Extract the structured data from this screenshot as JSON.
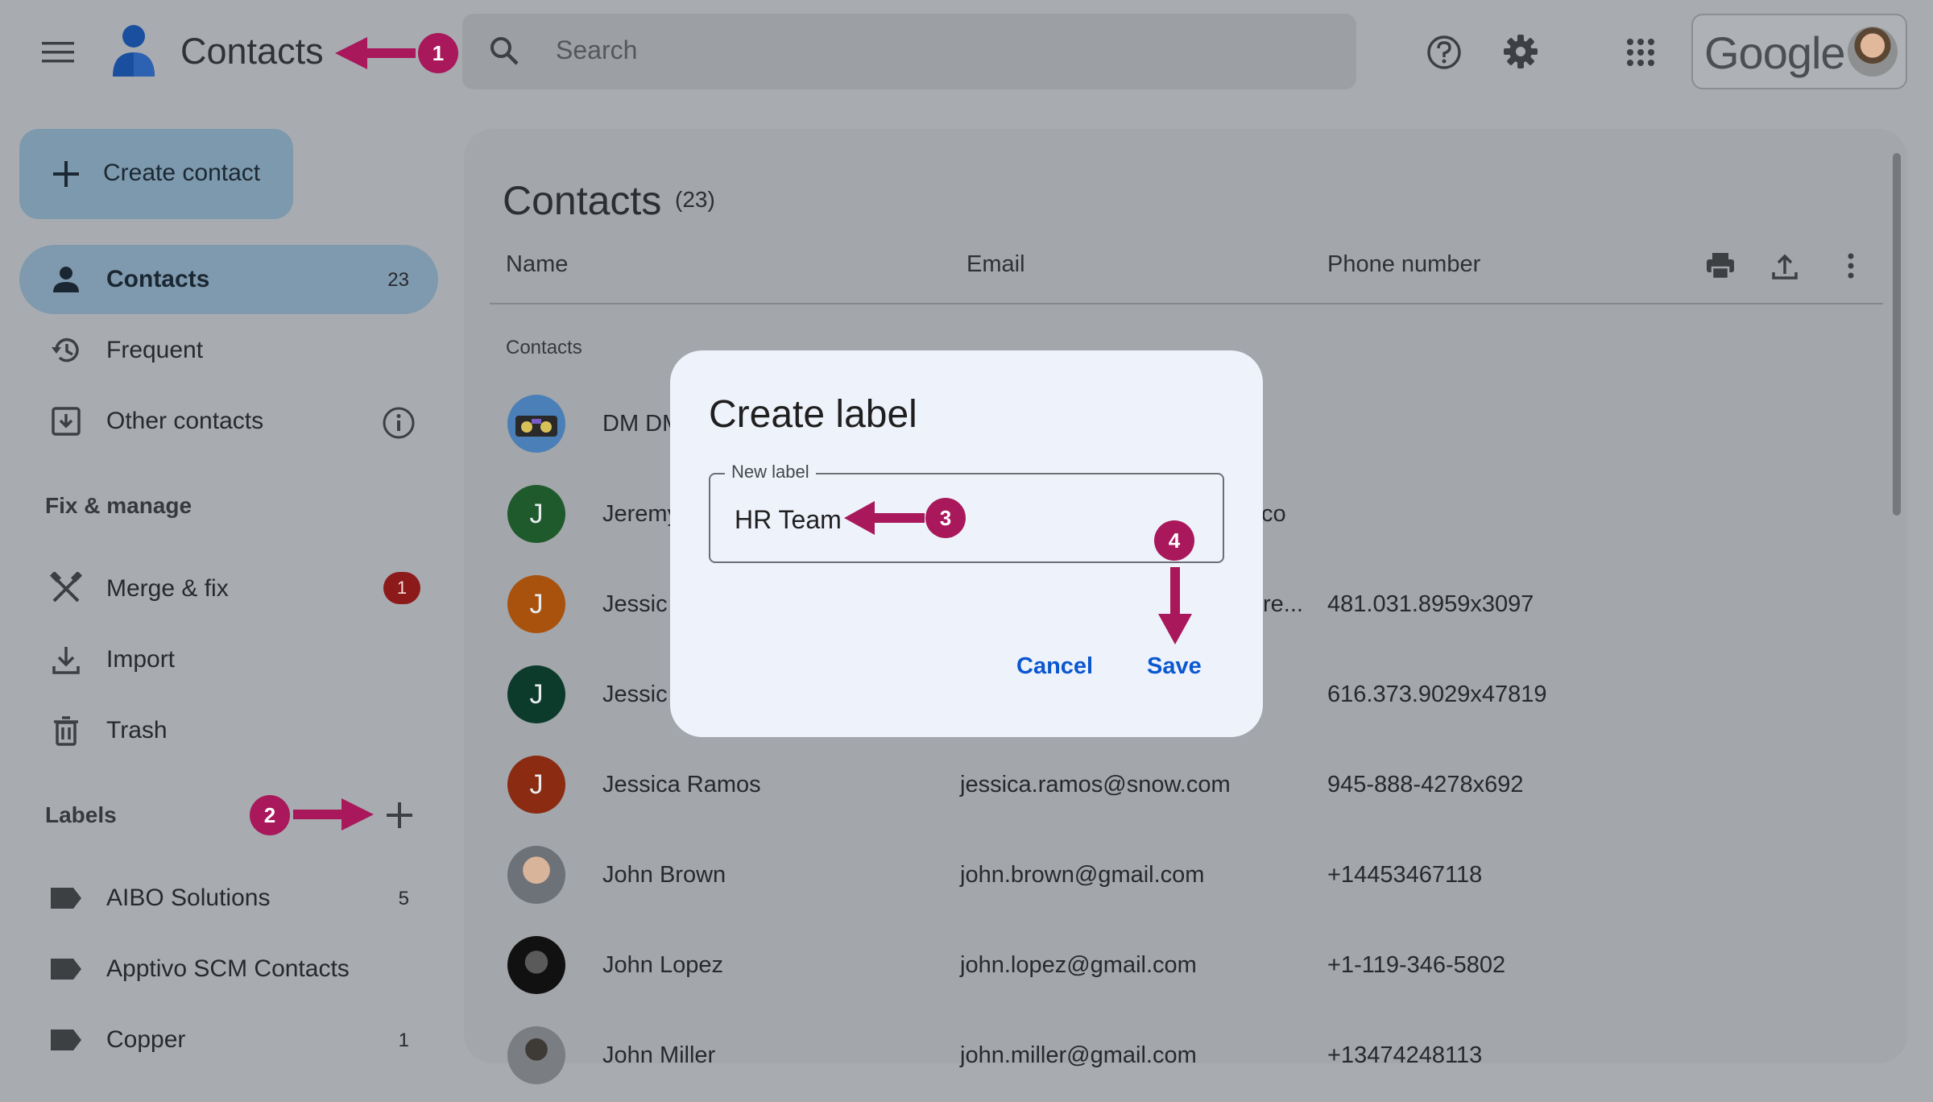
{
  "topbar": {
    "app_title": "Contacts",
    "search_placeholder": "Search",
    "brand": "Google"
  },
  "sidebar": {
    "create_label": "Create contact",
    "nav": [
      {
        "label": "Contacts",
        "count": "23",
        "icon": "person-icon",
        "active": true
      },
      {
        "label": "Frequent",
        "icon": "history-icon"
      },
      {
        "label": "Other contacts",
        "icon": "archive-icon"
      }
    ],
    "fix_title": "Fix & manage",
    "fix": [
      {
        "label": "Merge & fix",
        "badge": "1",
        "icon": "merge-icon"
      },
      {
        "label": "Import",
        "icon": "download-icon"
      },
      {
        "label": "Trash",
        "icon": "trash-icon"
      }
    ],
    "labels_title": "Labels",
    "labels": [
      {
        "label": "AIBO Solutions",
        "count": "5"
      },
      {
        "label": "Apptivo SCM Contacts",
        "count": ""
      },
      {
        "label": "Copper",
        "count": "1"
      }
    ]
  },
  "main": {
    "title": "Contacts",
    "count": "(23)",
    "columns": {
      "name": "Name",
      "email": "Email",
      "phone": "Phone number"
    },
    "group_label": "Contacts",
    "rows": [
      {
        "name": "DM DM",
        "email": "",
        "phone": "",
        "avatar": "",
        "color": "#3a6ea8"
      },
      {
        "name": "Jeremy",
        "email": "co",
        "phone": "",
        "avatar": "J",
        "color": "#1e5a2c"
      },
      {
        "name": "Jessic",
        "email": "re...",
        "phone": "481.031.8959x3097",
        "avatar": "J",
        "color": "#a8520e"
      },
      {
        "name": "Jessic",
        "email": "",
        "phone": "616.373.9029x47819",
        "avatar": "J",
        "color": "#0c3b2c"
      },
      {
        "name": "Jessica Ramos",
        "email": "jessica.ramos@snow.com",
        "phone": "945-888-4278x692",
        "avatar": "J",
        "color": "#8a2b12"
      },
      {
        "name": "John Brown",
        "email": "john.brown@gmail.com",
        "phone": "+14453467118",
        "avatar": "",
        "color": "#7a8088"
      },
      {
        "name": "John Lopez",
        "email": "john.lopez@gmail.com",
        "phone": "+1-119-346-5802",
        "avatar": "",
        "color": "#111111"
      },
      {
        "name": "John Miller",
        "email": "john.miller@gmail.com",
        "phone": "+13474248113",
        "avatar": "",
        "color": "#5d6066"
      }
    ]
  },
  "dialog": {
    "title": "Create label",
    "field_label": "New label",
    "field_value": "HR Team",
    "cancel": "Cancel",
    "save": "Save"
  },
  "annotations": {
    "step1": "1",
    "step2": "2",
    "step3": "3",
    "step4": "4",
    "color": "#a8185b"
  }
}
